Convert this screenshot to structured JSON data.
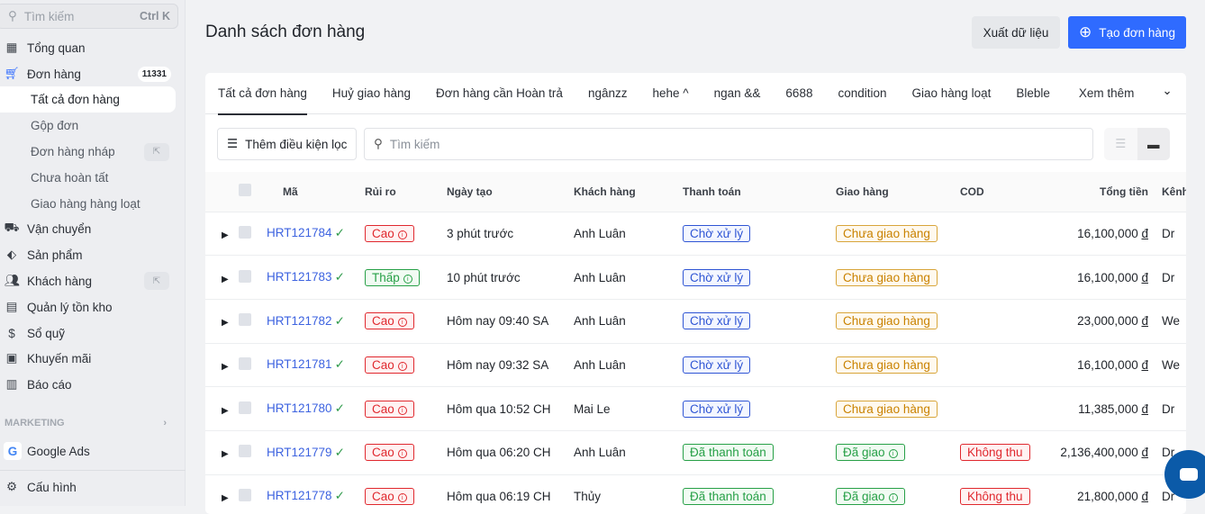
{
  "sidebar": {
    "search_placeholder": "Tìm kiếm",
    "shortcut": "Ctrl K",
    "items": [
      {
        "label": "Tổng quan",
        "icon": "dashboard-icon"
      },
      {
        "label": "Đơn hàng",
        "icon": "cart-icon",
        "badge": "11331"
      },
      {
        "label": "Vận chuyển",
        "icon": "truck-icon"
      },
      {
        "label": "Sản phẩm",
        "icon": "tag-icon"
      },
      {
        "label": "Khách hàng",
        "icon": "users-icon"
      },
      {
        "label": "Quản lý tồn kho",
        "icon": "archive-icon"
      },
      {
        "label": "Sổ quỹ",
        "icon": "dollar-icon"
      },
      {
        "label": "Khuyến mãi",
        "icon": "gift-icon"
      },
      {
        "label": "Báo cáo",
        "icon": "chart-icon"
      }
    ],
    "orders_sub": [
      "Tất cả đơn hàng",
      "Gộp đơn",
      "Đơn hàng nháp",
      "Chưa hoàn tất",
      "Giao hàng hàng loạt"
    ],
    "marketing_label": "MARKETING",
    "google_ads": "Google Ads",
    "settings": "Cấu hình"
  },
  "header": {
    "title": "Danh sách đơn hàng",
    "export": "Xuất dữ liệu",
    "create": "Tạo đơn hàng"
  },
  "tabs": [
    "Tất cả đơn hàng",
    "Huỷ giao hàng",
    "Đơn hàng cần Hoàn trả",
    "ngânzz",
    "hehe ^",
    "ngan &&",
    "6688",
    "condition",
    "Giao hàng loạt",
    "Bleble",
    "Xem thêm"
  ],
  "filter": {
    "add_filter": "Thêm điều kiện lọc",
    "search_placeholder": "Tìm kiếm"
  },
  "table": {
    "columns": [
      "Mã",
      "Rủi ro",
      "Ngày tạo",
      "Khách hàng",
      "Thanh toán",
      "Giao hàng",
      "COD",
      "Tổng tiền",
      "Kênh"
    ],
    "rows": [
      {
        "code": "HRT121784",
        "risk": "Cao",
        "created": "3 phút trước",
        "customer": "Anh Luân",
        "payment": "Chờ xử lý",
        "shipping": "Chưa giao hàng",
        "cod": "",
        "total": "16,100,000",
        "currency": "đ",
        "channel": "Dr"
      },
      {
        "code": "HRT121783",
        "risk": "Thấp",
        "created": "10 phút trước",
        "customer": "Anh Luân",
        "payment": "Chờ xử lý",
        "shipping": "Chưa giao hàng",
        "cod": "",
        "total": "16,100,000",
        "currency": "đ",
        "channel": "Dr"
      },
      {
        "code": "HRT121782",
        "risk": "Cao",
        "created": "Hôm nay 09:40 SA",
        "customer": "Anh Luân",
        "payment": "Chờ xử lý",
        "shipping": "Chưa giao hàng",
        "cod": "",
        "total": "23,000,000",
        "currency": "đ",
        "channel": "We"
      },
      {
        "code": "HRT121781",
        "risk": "Cao",
        "created": "Hôm nay 09:32 SA",
        "customer": "Anh Luân",
        "payment": "Chờ xử lý",
        "shipping": "Chưa giao hàng",
        "cod": "",
        "total": "16,100,000",
        "currency": "đ",
        "channel": "We"
      },
      {
        "code": "HRT121780",
        "risk": "Cao",
        "created": "Hôm qua 10:52 CH",
        "customer": "Mai Le",
        "payment": "Chờ xử lý",
        "shipping": "Chưa giao hàng",
        "cod": "",
        "total": "11,385,000",
        "currency": "đ",
        "channel": "Dr"
      },
      {
        "code": "HRT121779",
        "risk": "Cao",
        "created": "Hôm qua 06:20 CH",
        "customer": "Anh Luân",
        "payment": "Đã thanh toán",
        "shipping": "Đã giao",
        "cod": "Không thu",
        "total": "2,136,400,000",
        "currency": "đ",
        "channel": "Dr"
      },
      {
        "code": "HRT121778",
        "risk": "Cao",
        "created": "Hôm qua 06:19 CH",
        "customer": "Thủy",
        "payment": "Đã thanh toán",
        "shipping": "Đã giao",
        "cod": "Không thu",
        "total": "21,800,000",
        "currency": "đ",
        "channel": "Dr"
      }
    ]
  },
  "colors": {
    "primary": "#2f6bff",
    "danger": "#e0282e",
    "success": "#27a047",
    "link": "#3d63e0",
    "warning": "#c98200"
  }
}
